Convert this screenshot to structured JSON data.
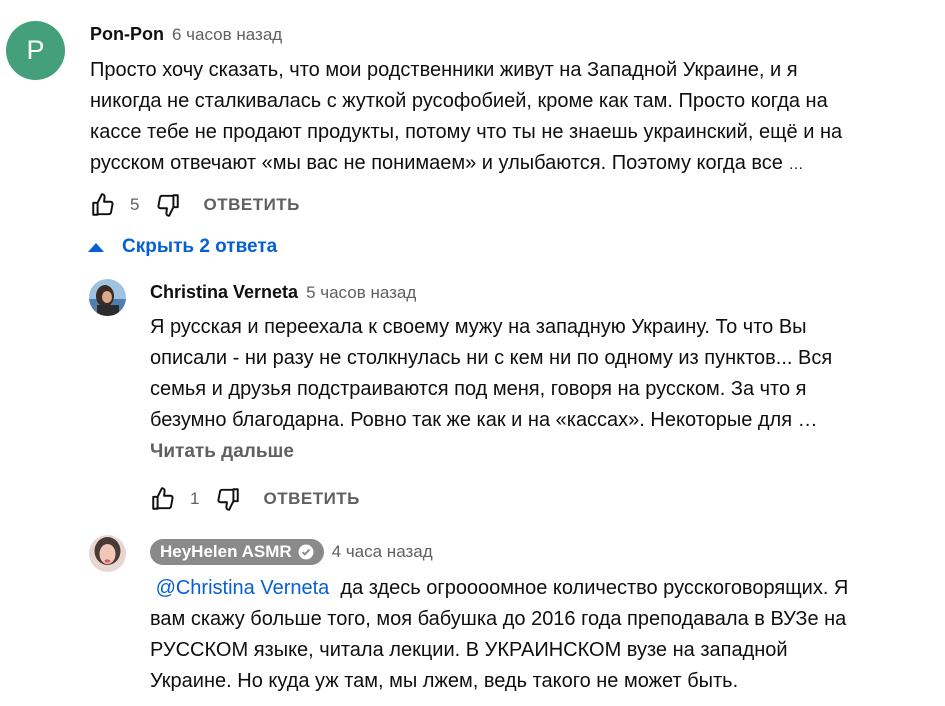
{
  "comment": {
    "avatar_letter": "P",
    "author": "Pon-Pon",
    "time": "6 часов назад",
    "lines": [
      "Просто хочу сказать, что мои родственники живут на Западной Украине, и я",
      "никогда не сталкивалась с жуткой русофобией, кроме как там. Просто когда на",
      "кассе тебе не продают продукты, потому что ты не знаешь украинский, ещё и на",
      "русском отвечают «мы вас не понимаем» и улыбаются. Поэтому когда все"
    ],
    "ellipsis": "…",
    "likes": "5",
    "reply_label": "ОТВЕТИТЬ"
  },
  "replies_toggle": {
    "label": "Скрыть 2 ответа"
  },
  "reply1": {
    "author": "Christina Verneta",
    "time": "5 часов назад",
    "lines": [
      "Я русская и переехала к своему мужу на западную Украину. То что Вы",
      "описали - ни разу не столкнулась ни с кем ни по одному из пунктов... Вся",
      "семья и друзья подстраиваются под меня, говоря на русском. За что я",
      "безумно благодарна. Ровно так же как и на «кассах». Некоторые для …"
    ],
    "read_more": "Читать дальше",
    "likes": "1",
    "reply_label": "ОТВЕТИТЬ"
  },
  "reply2": {
    "author": "HeyHelen ASMR",
    "time": "4 часа назад",
    "mention": "@Christina Verneta",
    "first_line_rest": "да здесь огроооомное количество русскоговорящих. Я",
    "lines": [
      "вам скажу больше того, моя бабушка до 2016 года преподавала в ВУЗе на",
      "РУССКОМ языке, читала лекции. В УКРАИНСКОМ вузе на западной",
      "Украине. Но куда уж там, мы лжем, ведь такого не может быть."
    ]
  },
  "colors": {
    "avatar_bg": "#43a07a",
    "link": "#065fd4",
    "secondary_text": "#606060",
    "chip_bg": "#8a8a8a"
  },
  "icons": [
    "thumb-up-icon",
    "thumb-down-icon",
    "caret-up-icon",
    "verified-check-icon"
  ]
}
